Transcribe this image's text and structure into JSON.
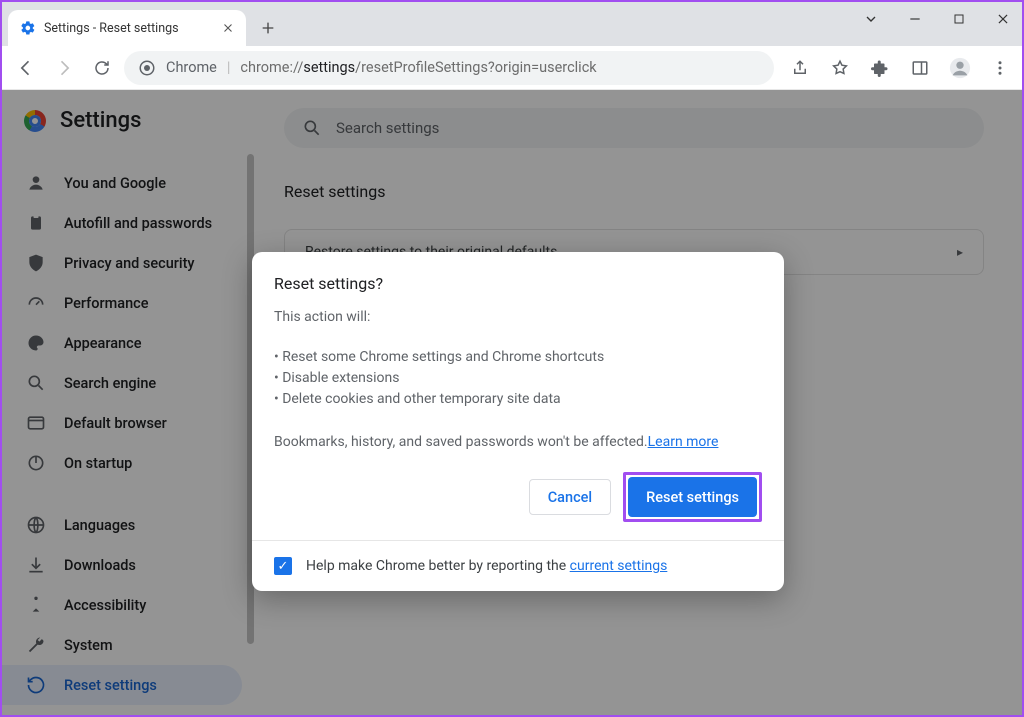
{
  "tab": {
    "title": "Settings - Reset settings"
  },
  "omnibox": {
    "chrome_label": "Chrome",
    "url_prefix": "chrome://",
    "url_bold": "settings",
    "url_rest": "/resetProfileSettings?origin=userclick"
  },
  "brand": {
    "title": "Settings"
  },
  "search": {
    "placeholder": "Search settings"
  },
  "sidebar": {
    "items": [
      {
        "label": "You and Google"
      },
      {
        "label": "Autofill and passwords"
      },
      {
        "label": "Privacy and security"
      },
      {
        "label": "Performance"
      },
      {
        "label": "Appearance"
      },
      {
        "label": "Search engine"
      },
      {
        "label": "Default browser"
      },
      {
        "label": "On startup"
      },
      {
        "label": "Languages"
      },
      {
        "label": "Downloads"
      },
      {
        "label": "Accessibility"
      },
      {
        "label": "System"
      },
      {
        "label": "Reset settings"
      }
    ]
  },
  "section": {
    "title": "Reset settings"
  },
  "row": {
    "label": "Restore settings to their original defaults"
  },
  "dialog": {
    "title": "Reset settings?",
    "sub": "This action will:",
    "li1": "• Reset some Chrome settings and Chrome shortcuts",
    "li2": "• Disable extensions",
    "li3": "• Delete cookies and other temporary site data",
    "note_pre": "Bookmarks, history, and saved passwords won't be affected.",
    "learn_more": "Learn more",
    "cancel": "Cancel",
    "confirm": "Reset settings",
    "footer_pre": "Help make Chrome better by reporting the ",
    "footer_link": "current settings"
  }
}
